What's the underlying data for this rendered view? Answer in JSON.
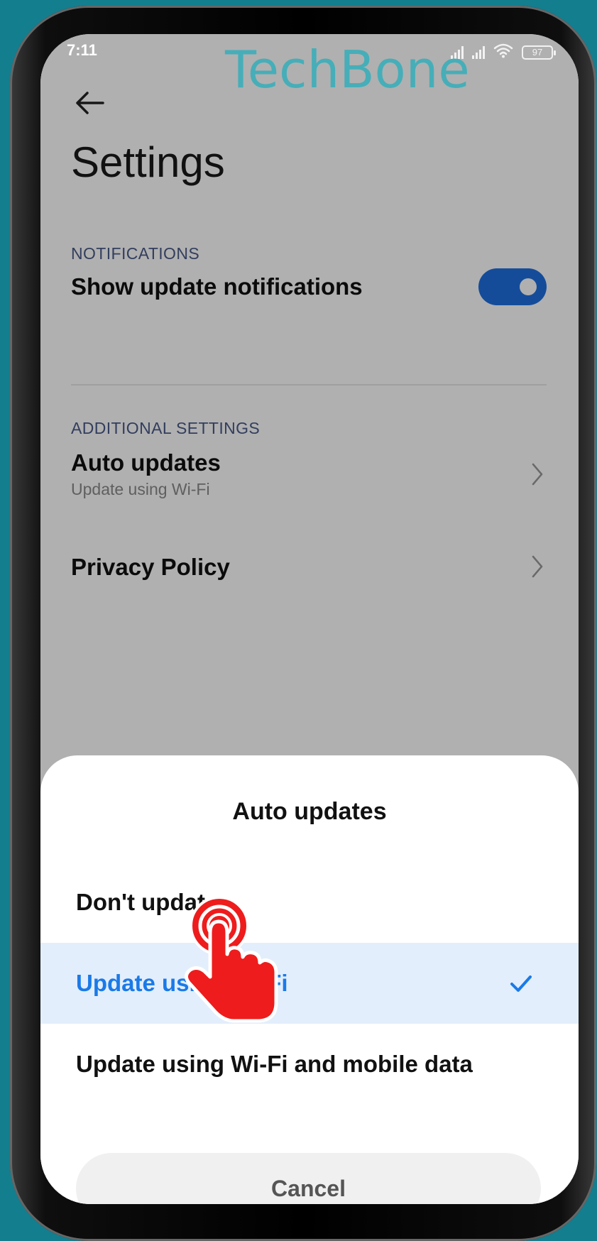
{
  "status_bar": {
    "time": "7:11",
    "battery": "97"
  },
  "watermark": "TechBone",
  "header": {
    "title": "Settings"
  },
  "notifications": {
    "section_label": "NOTIFICATIONS",
    "show_updates_label": "Show update notifications",
    "show_updates_enabled": true
  },
  "additional": {
    "section_label": "ADDITIONAL SETTINGS",
    "auto_updates_title": "Auto updates",
    "auto_updates_value": "Update using Wi-Fi",
    "privacy_policy": "Privacy Policy"
  },
  "dialog": {
    "title": "Auto updates",
    "options": [
      {
        "label": "Don't update",
        "selected": false
      },
      {
        "label": "Update using Wi-Fi",
        "selected": true
      },
      {
        "label": "Update using Wi-Fi and mobile data",
        "selected": false
      }
    ],
    "cancel_label": "Cancel"
  },
  "colors": {
    "accent": "#1a7ae8",
    "toggle_on": "#1f6fe0",
    "background": "#137e8e",
    "tap_indicator": "#ee1c1c"
  }
}
